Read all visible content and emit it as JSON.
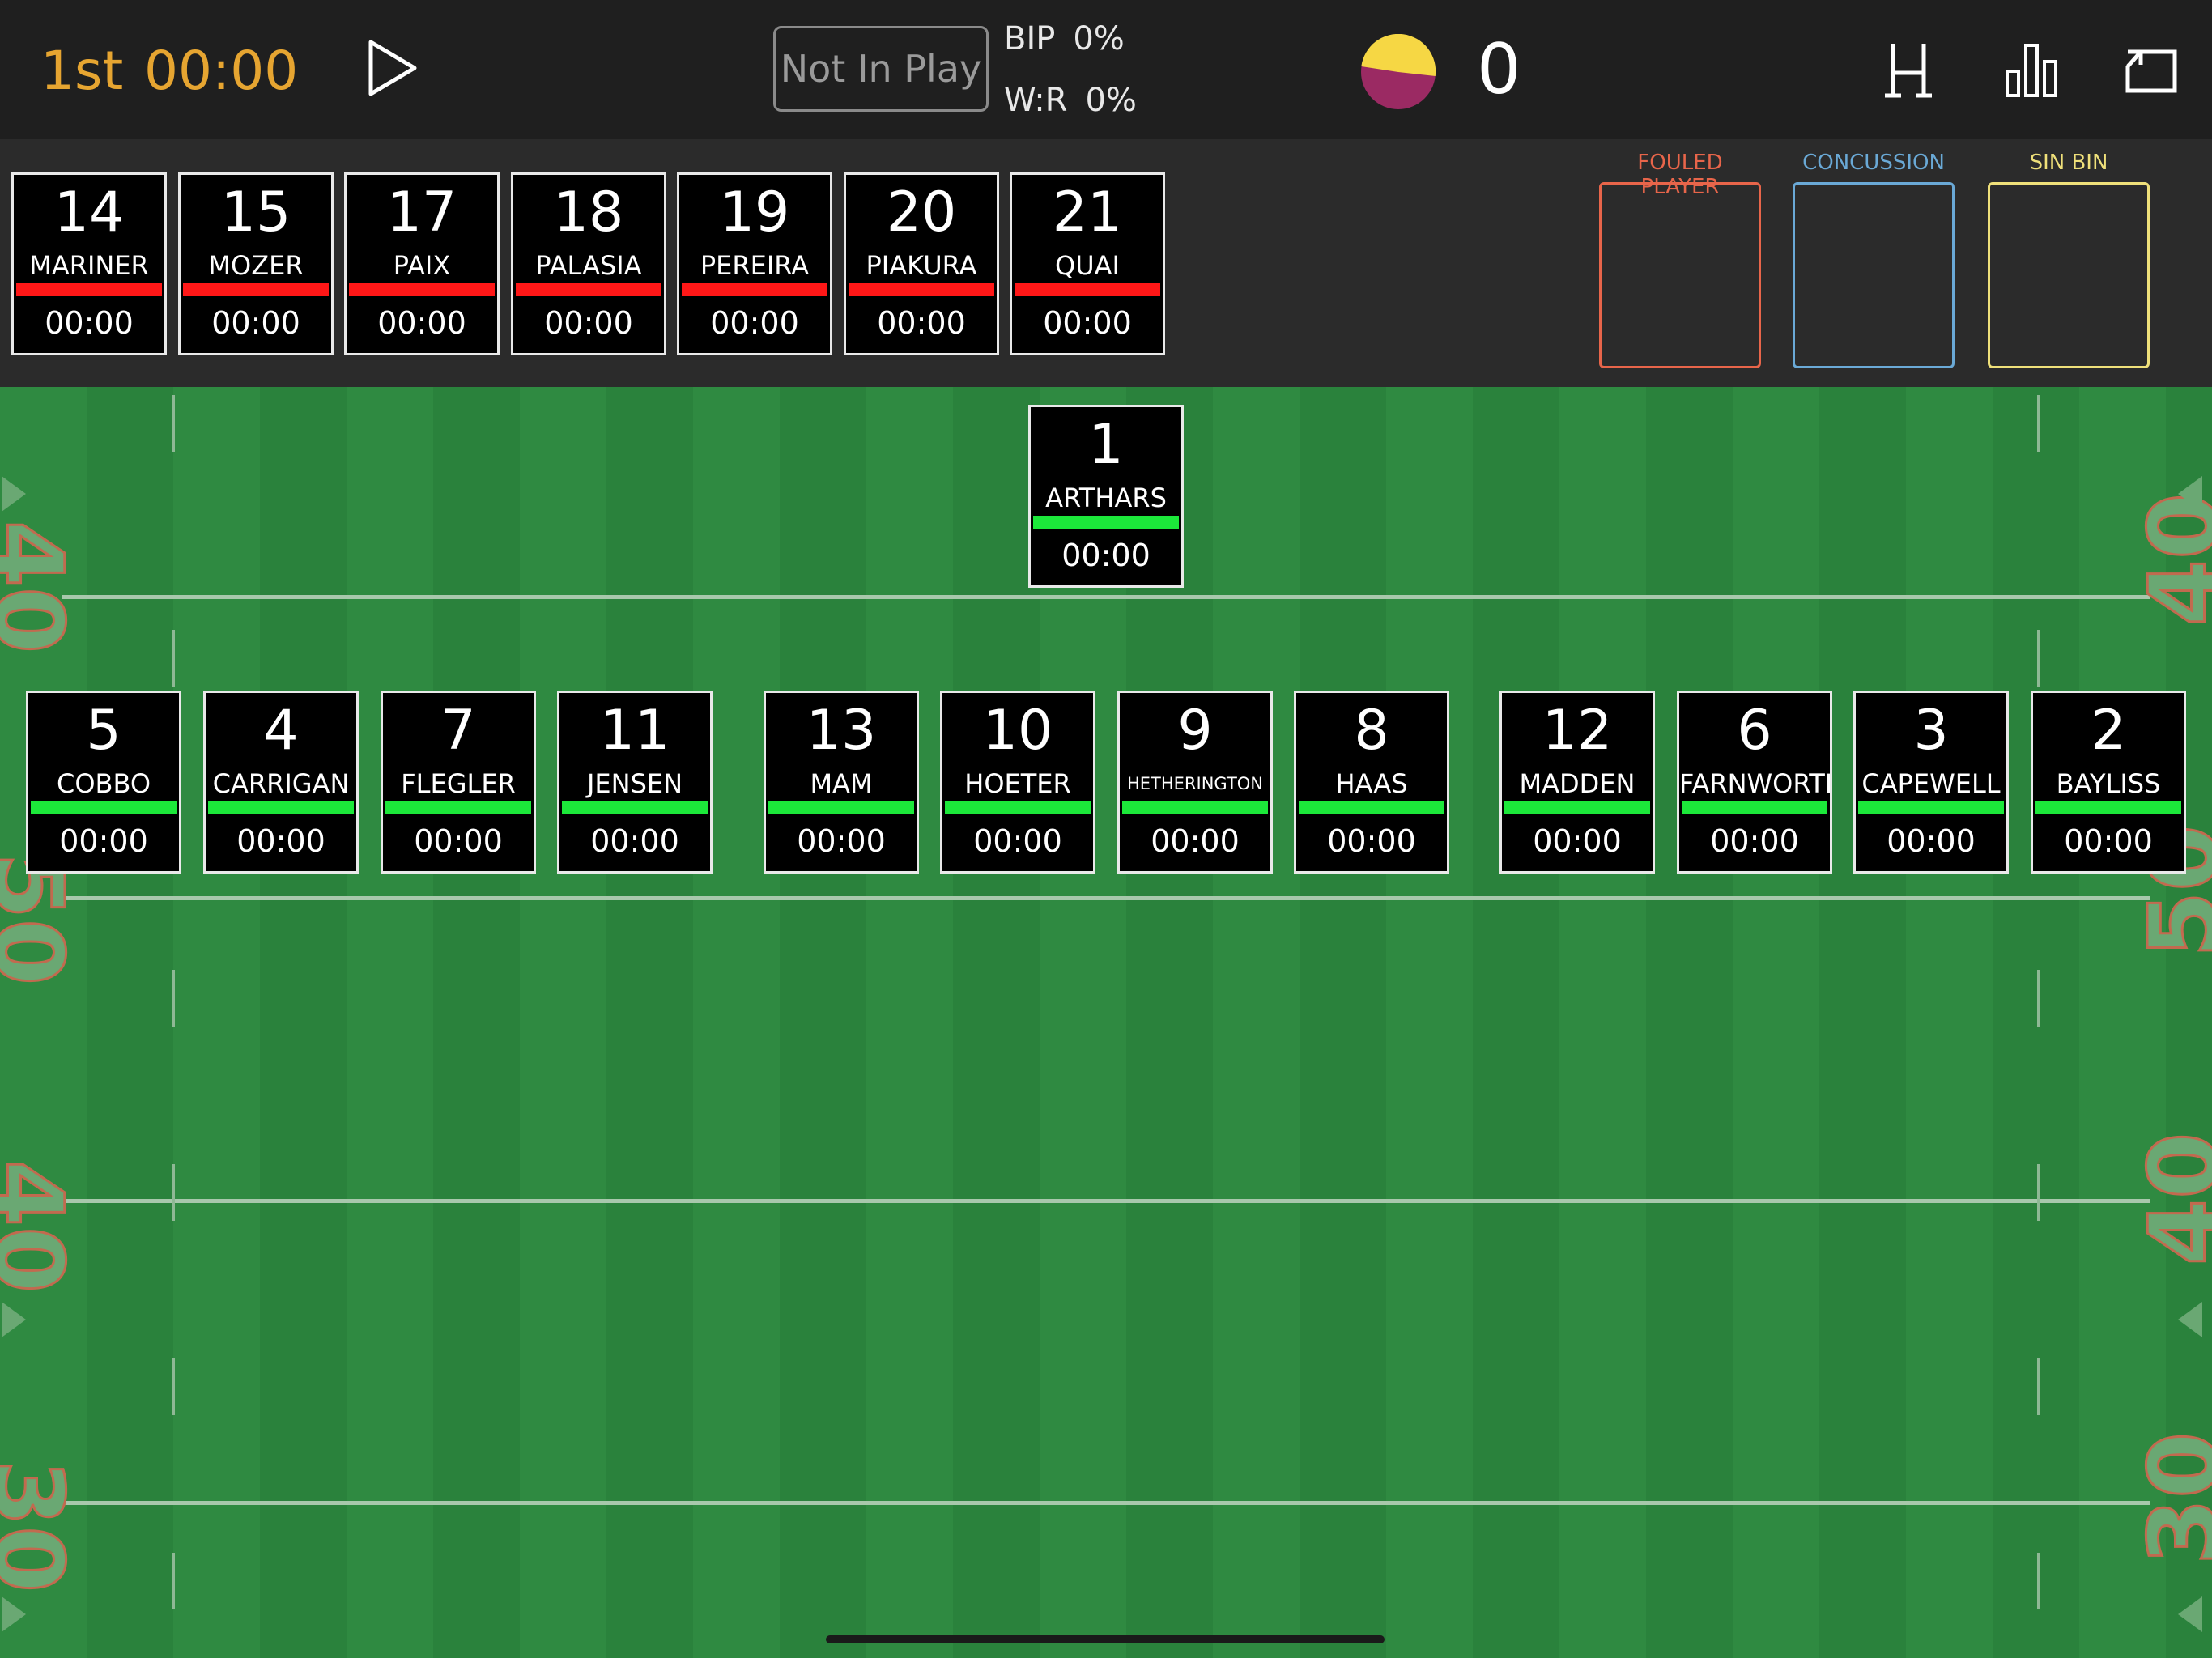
{
  "header": {
    "period": "1st",
    "clock": "00:00",
    "play_state_label": "Not In Play",
    "bip_label": "BIP",
    "bip_value": "0%",
    "wr_label": "W:R",
    "wr_value": "0%",
    "score": "0",
    "team_colors": [
      "#f6d744",
      "#9b2a63"
    ],
    "icons": [
      "play-icon",
      "goalposts-icon",
      "bar-chart-icon",
      "exit-icon"
    ]
  },
  "bench": [
    {
      "number": "14",
      "name": "MARINER",
      "time": "00:00"
    },
    {
      "number": "15",
      "name": "MOZER",
      "time": "00:00"
    },
    {
      "number": "17",
      "name": "PAIX",
      "time": "00:00"
    },
    {
      "number": "18",
      "name": "PALASIA",
      "time": "00:00"
    },
    {
      "number": "19",
      "name": "PEREIRA",
      "time": "00:00"
    },
    {
      "number": "20",
      "name": "PIAKURA",
      "time": "00:00"
    },
    {
      "number": "21",
      "name": "QUAI",
      "time": "00:00"
    }
  ],
  "status_slots": [
    {
      "label": "FOULED PLAYER",
      "color": "#e8654a"
    },
    {
      "label": "CONCUSSION",
      "color": "#6aa9d6"
    },
    {
      "label": "SIN BIN",
      "color": "#efe07a"
    }
  ],
  "field": {
    "fullback": {
      "number": "1",
      "name": "ARTHARS",
      "time": "00:00"
    },
    "players": [
      {
        "number": "5",
        "name": "COBBO",
        "time": "00:00"
      },
      {
        "number": "4",
        "name": "CARRIGAN",
        "time": "00:00"
      },
      {
        "number": "7",
        "name": "FLEGLER",
        "time": "00:00"
      },
      {
        "number": "11",
        "name": "JENSEN",
        "time": "00:00"
      },
      {
        "number": "13",
        "name": "MAM",
        "time": "00:00"
      },
      {
        "number": "10",
        "name": "HOETER",
        "time": "00:00"
      },
      {
        "number": "9",
        "name": "HETHERINGTON",
        "time": "00:00"
      },
      {
        "number": "8",
        "name": "HAAS",
        "time": "00:00"
      },
      {
        "number": "12",
        "name": "MADDEN",
        "time": "00:00"
      },
      {
        "number": "6",
        "name": "FARNWORTH",
        "time": "00:00"
      },
      {
        "number": "3",
        "name": "CAPEWELL",
        "time": "00:00"
      },
      {
        "number": "2",
        "name": "BAYLISS",
        "time": "00:00"
      }
    ],
    "yard_markers": [
      "40",
      "50",
      "40",
      "30"
    ]
  }
}
